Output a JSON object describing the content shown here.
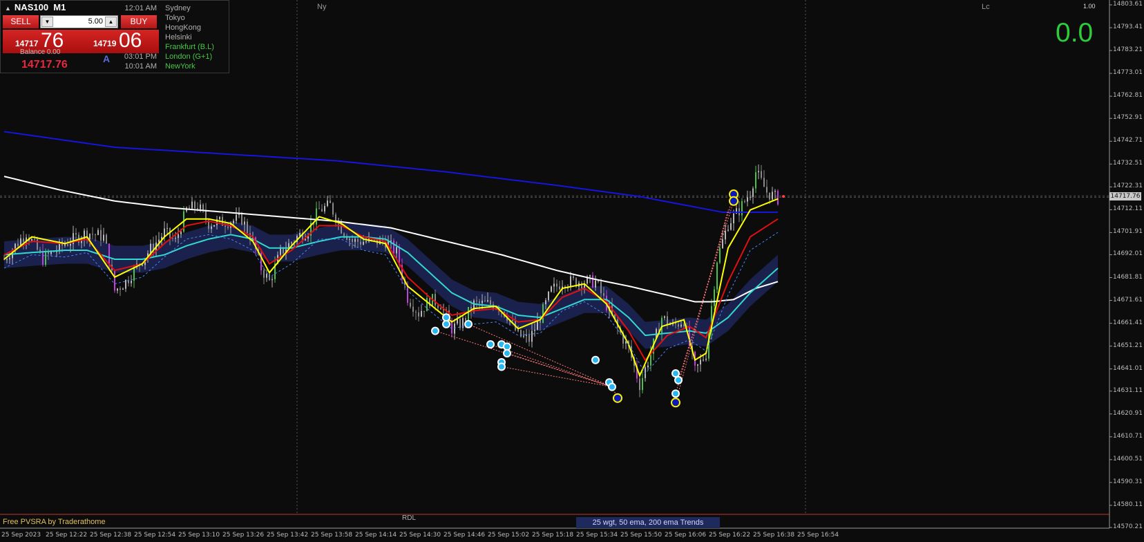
{
  "colors": {
    "background": "#0c0c0c",
    "bull_candle": "#b9b9b9",
    "bear_candle": "#8a8a8a",
    "climax_up": "#4cc24c",
    "climax_down": "#c040d8",
    "ema_fast": "#ffff00",
    "ema_mid": "#e01010",
    "ema_50": "#32d9d0",
    "ema_50_band": "#1c2353",
    "ema_200": "#ffffff",
    "ema_800": "#1515e0",
    "zigzag": "#ff7a7a",
    "marker": "#2ab6f0",
    "marker_big": "#0a1ab8"
  },
  "panel": {
    "symbol": "NAS100",
    "timeframe": "M1",
    "sell_label": "SELL",
    "buy_label": "BUY",
    "lot_value": "5.00",
    "sell_quote_small": "14717",
    "sell_quote_big": "76",
    "buy_quote_small": "14719",
    "buy_quote_big": "06",
    "balance_label": "Balance 0.00",
    "price": "14717.76",
    "mode": "A"
  },
  "sessions": [
    {
      "time": "12:01 AM",
      "name": "Sydney",
      "color": "#b0b0b0"
    },
    {
      "time": "",
      "name": "Tokyo",
      "color": "#b0b0b0"
    },
    {
      "time": "",
      "name": "HongKong",
      "color": "#b0b0b0"
    },
    {
      "time": "",
      "name": "Helsinki",
      "color": "#b0b0b0"
    },
    {
      "time": "",
      "name": "Frankfurt (B.L)",
      "color": "#44c844"
    },
    {
      "time": "03:01 PM",
      "name": "London (G+1)",
      "color": "#44c844"
    },
    {
      "time": "10:01 AM",
      "name": "NewYork",
      "color": "#44c844"
    }
  ],
  "display": {
    "big_value": "0.0",
    "top_right": "1.00",
    "current_price_tag": "14717.76",
    "session_ny": "Ny",
    "session_lc": "Lc",
    "rdl": "RDL",
    "footer_left": "Free PVSRA by Traderathome",
    "footer_trend": "25 wgt, 50 ema, 200 ema Trends"
  },
  "chart_data": {
    "type": "candlestick",
    "symbol": "NAS100",
    "timeframe": "M1",
    "ylim": [
      14570.21,
      14803.61
    ],
    "yticks": [
      "14803.61",
      "14793.41",
      "14783.21",
      "14773.01",
      "14762.81",
      "14752.91",
      "14742.71",
      "14732.51",
      "14722.31",
      "14712.11",
      "14701.91",
      "14692.01",
      "14681.81",
      "14671.61",
      "14661.41",
      "14651.21",
      "14641.01",
      "14631.11",
      "14620.91",
      "14610.71",
      "14600.51",
      "14590.31",
      "14580.11",
      "14570.21"
    ],
    "xticks": [
      "25 Sep 2023",
      "25 Sep 12:22",
      "25 Sep 12:38",
      "25 Sep 12:54",
      "25 Sep 13:10",
      "25 Sep 13:26",
      "25 Sep 13:42",
      "25 Sep 13:58",
      "25 Sep 14:14",
      "25 Sep 14:30",
      "25 Sep 14:46",
      "25 Sep 15:02",
      "25 Sep 15:18",
      "25 Sep 15:34",
      "25 Sep 15:50",
      "25 Sep 16:06",
      "25 Sep 16:22",
      "25 Sep 16:38",
      "25 Sep 16:54"
    ],
    "first_minute": "12:06",
    "last_minute": "16:56",
    "current_price": 14717.76,
    "price_path": [
      [
        0,
        14690
      ],
      [
        8,
        14702
      ],
      [
        14,
        14690
      ],
      [
        22,
        14697
      ],
      [
        30,
        14702
      ],
      [
        36,
        14700
      ],
      [
        38,
        14690
      ],
      [
        40,
        14676
      ],
      [
        44,
        14680
      ],
      [
        50,
        14690
      ],
      [
        58,
        14702
      ],
      [
        62,
        14698
      ],
      [
        66,
        14712
      ],
      [
        70,
        14714
      ],
      [
        74,
        14706
      ],
      [
        82,
        14707
      ],
      [
        86,
        14708
      ],
      [
        90,
        14698
      ],
      [
        93,
        14686
      ],
      [
        96,
        14680
      ],
      [
        100,
        14693
      ],
      [
        106,
        14700
      ],
      [
        110,
        14703
      ],
      [
        114,
        14712
      ],
      [
        118,
        14714
      ],
      [
        122,
        14704
      ],
      [
        126,
        14698
      ],
      [
        130,
        14698
      ],
      [
        138,
        14698
      ],
      [
        142,
        14693
      ],
      [
        146,
        14673
      ],
      [
        150,
        14666
      ],
      [
        154,
        14672
      ],
      [
        158,
        14670
      ],
      [
        162,
        14659
      ],
      [
        166,
        14662
      ],
      [
        170,
        14670
      ],
      [
        178,
        14670
      ],
      [
        182,
        14665
      ],
      [
        186,
        14656
      ],
      [
        190,
        14654
      ],
      [
        194,
        14664
      ],
      [
        198,
        14676
      ],
      [
        202,
        14680
      ],
      [
        210,
        14680
      ],
      [
        214,
        14680
      ],
      [
        222,
        14659
      ],
      [
        226,
        14650
      ],
      [
        230,
        14634
      ],
      [
        234,
        14648
      ],
      [
        238,
        14664
      ],
      [
        242,
        14660
      ],
      [
        246,
        14663
      ],
      [
        250,
        14640
      ],
      [
        254,
        14648
      ],
      [
        258,
        14690
      ],
      [
        262,
        14706
      ],
      [
        266,
        14712
      ],
      [
        270,
        14720
      ],
      [
        272,
        14729
      ],
      [
        276,
        14720
      ],
      [
        280,
        14717
      ]
    ],
    "series": [
      {
        "name": "25 wgt",
        "values": [
          [
            0,
            14690
          ],
          [
            10,
            14700
          ],
          [
            22,
            14697
          ],
          [
            30,
            14700
          ],
          [
            40,
            14682
          ],
          [
            50,
            14688
          ],
          [
            58,
            14700
          ],
          [
            66,
            14708
          ],
          [
            74,
            14708
          ],
          [
            82,
            14706
          ],
          [
            90,
            14698
          ],
          [
            96,
            14684
          ],
          [
            104,
            14696
          ],
          [
            114,
            14709
          ],
          [
            122,
            14706
          ],
          [
            130,
            14699
          ],
          [
            138,
            14697
          ],
          [
            146,
            14678
          ],
          [
            154,
            14670
          ],
          [
            162,
            14662
          ],
          [
            170,
            14668
          ],
          [
            178,
            14669
          ],
          [
            186,
            14659
          ],
          [
            194,
            14663
          ],
          [
            202,
            14677
          ],
          [
            210,
            14679
          ],
          [
            218,
            14670
          ],
          [
            226,
            14652
          ],
          [
            230,
            14638
          ],
          [
            238,
            14660
          ],
          [
            246,
            14663
          ],
          [
            250,
            14645
          ],
          [
            254,
            14648
          ],
          [
            262,
            14695
          ],
          [
            270,
            14712
          ],
          [
            276,
            14715
          ],
          [
            280,
            14717
          ]
        ]
      },
      {
        "name": "ema red",
        "values": [
          [
            0,
            14692
          ],
          [
            10,
            14698
          ],
          [
            22,
            14697
          ],
          [
            30,
            14699
          ],
          [
            40,
            14685
          ],
          [
            50,
            14688
          ],
          [
            58,
            14697
          ],
          [
            66,
            14705
          ],
          [
            74,
            14707
          ],
          [
            82,
            14705
          ],
          [
            90,
            14700
          ],
          [
            96,
            14688
          ],
          [
            104,
            14694
          ],
          [
            114,
            14705
          ],
          [
            122,
            14705
          ],
          [
            130,
            14700
          ],
          [
            138,
            14698
          ],
          [
            146,
            14682
          ],
          [
            154,
            14673
          ],
          [
            162,
            14665
          ],
          [
            170,
            14667
          ],
          [
            178,
            14668
          ],
          [
            186,
            14662
          ],
          [
            194,
            14663
          ],
          [
            202,
            14673
          ],
          [
            210,
            14677
          ],
          [
            218,
            14671
          ],
          [
            226,
            14658
          ],
          [
            232,
            14645
          ],
          [
            240,
            14656
          ],
          [
            248,
            14660
          ],
          [
            254,
            14655
          ],
          [
            262,
            14680
          ],
          [
            270,
            14700
          ],
          [
            280,
            14708
          ]
        ]
      },
      {
        "name": "50 ema",
        "values": [
          [
            0,
            14692
          ],
          [
            10,
            14693
          ],
          [
            22,
            14694
          ],
          [
            30,
            14694
          ],
          [
            40,
            14690
          ],
          [
            50,
            14690
          ],
          [
            58,
            14692
          ],
          [
            66,
            14696
          ],
          [
            74,
            14699
          ],
          [
            82,
            14701
          ],
          [
            90,
            14699
          ],
          [
            96,
            14695
          ],
          [
            104,
            14695
          ],
          [
            114,
            14698
          ],
          [
            122,
            14700
          ],
          [
            130,
            14700
          ],
          [
            138,
            14699
          ],
          [
            146,
            14693
          ],
          [
            154,
            14684
          ],
          [
            162,
            14675
          ],
          [
            170,
            14670
          ],
          [
            178,
            14669
          ],
          [
            186,
            14665
          ],
          [
            194,
            14664
          ],
          [
            202,
            14668
          ],
          [
            210,
            14672
          ],
          [
            218,
            14672
          ],
          [
            226,
            14664
          ],
          [
            232,
            14656
          ],
          [
            240,
            14657
          ],
          [
            248,
            14658
          ],
          [
            254,
            14657
          ],
          [
            262,
            14664
          ],
          [
            270,
            14675
          ],
          [
            280,
            14686
          ]
        ]
      },
      {
        "name": "200 ema",
        "values": [
          [
            0,
            14727
          ],
          [
            20,
            14721
          ],
          [
            40,
            14716
          ],
          [
            60,
            14713
          ],
          [
            80,
            14711
          ],
          [
            100,
            14709
          ],
          [
            120,
            14707
          ],
          [
            140,
            14704
          ],
          [
            160,
            14698
          ],
          [
            180,
            14692
          ],
          [
            200,
            14685
          ],
          [
            214,
            14681
          ],
          [
            226,
            14678
          ],
          [
            240,
            14674
          ],
          [
            250,
            14671
          ],
          [
            256,
            14671
          ],
          [
            264,
            14672
          ],
          [
            272,
            14677
          ],
          [
            280,
            14680
          ]
        ]
      },
      {
        "name": "800 ema",
        "values": [
          [
            0,
            14747
          ],
          [
            40,
            14740
          ],
          [
            80,
            14737
          ],
          [
            120,
            14734
          ],
          [
            160,
            14729
          ],
          [
            200,
            14723
          ],
          [
            230,
            14718
          ],
          [
            260,
            14711
          ],
          [
            280,
            14711
          ]
        ]
      }
    ],
    "markers": [
      [
        156,
        14658,
        "small"
      ],
      [
        160,
        14664,
        "small"
      ],
      [
        160,
        14661,
        "small"
      ],
      [
        168,
        14661,
        "small"
      ],
      [
        176,
        14652,
        "small"
      ],
      [
        180,
        14652,
        "small"
      ],
      [
        182,
        14651,
        "small"
      ],
      [
        182,
        14648,
        "small"
      ],
      [
        180,
        14644,
        "small"
      ],
      [
        180,
        14642,
        "small"
      ],
      [
        214,
        14645,
        "small"
      ],
      [
        219,
        14635,
        "small"
      ],
      [
        220,
        14633,
        "small"
      ],
      [
        222,
        14628,
        "big"
      ],
      [
        243,
        14639,
        "small"
      ],
      [
        244,
        14636,
        "small"
      ],
      [
        243,
        14630,
        "small"
      ],
      [
        243,
        14626,
        "big"
      ],
      [
        264,
        14719,
        "big"
      ],
      [
        264,
        14716,
        "big"
      ]
    ],
    "zigzag": [
      [
        [
          156,
          14658
        ],
        [
          220,
          14633
        ]
      ],
      [
        [
          168,
          14661
        ],
        [
          220,
          14633
        ]
      ],
      [
        [
          176,
          14652
        ],
        [
          220,
          14633
        ]
      ],
      [
        [
          182,
          14648
        ],
        [
          220,
          14633
        ]
      ],
      [
        [
          180,
          14642
        ],
        [
          220,
          14633
        ]
      ],
      [
        [
          222,
          14628
        ],
        [
          220,
          14633
        ]
      ],
      [
        [
          243,
          14630
        ],
        [
          264,
          14719
        ]
      ],
      [
        [
          244,
          14636
        ],
        [
          264,
          14716
        ]
      ],
      [
        [
          243,
          14626
        ],
        [
          262,
          14712
        ]
      ]
    ],
    "session_lines": [
      "13:52",
      "16:56"
    ],
    "grid": false
  }
}
